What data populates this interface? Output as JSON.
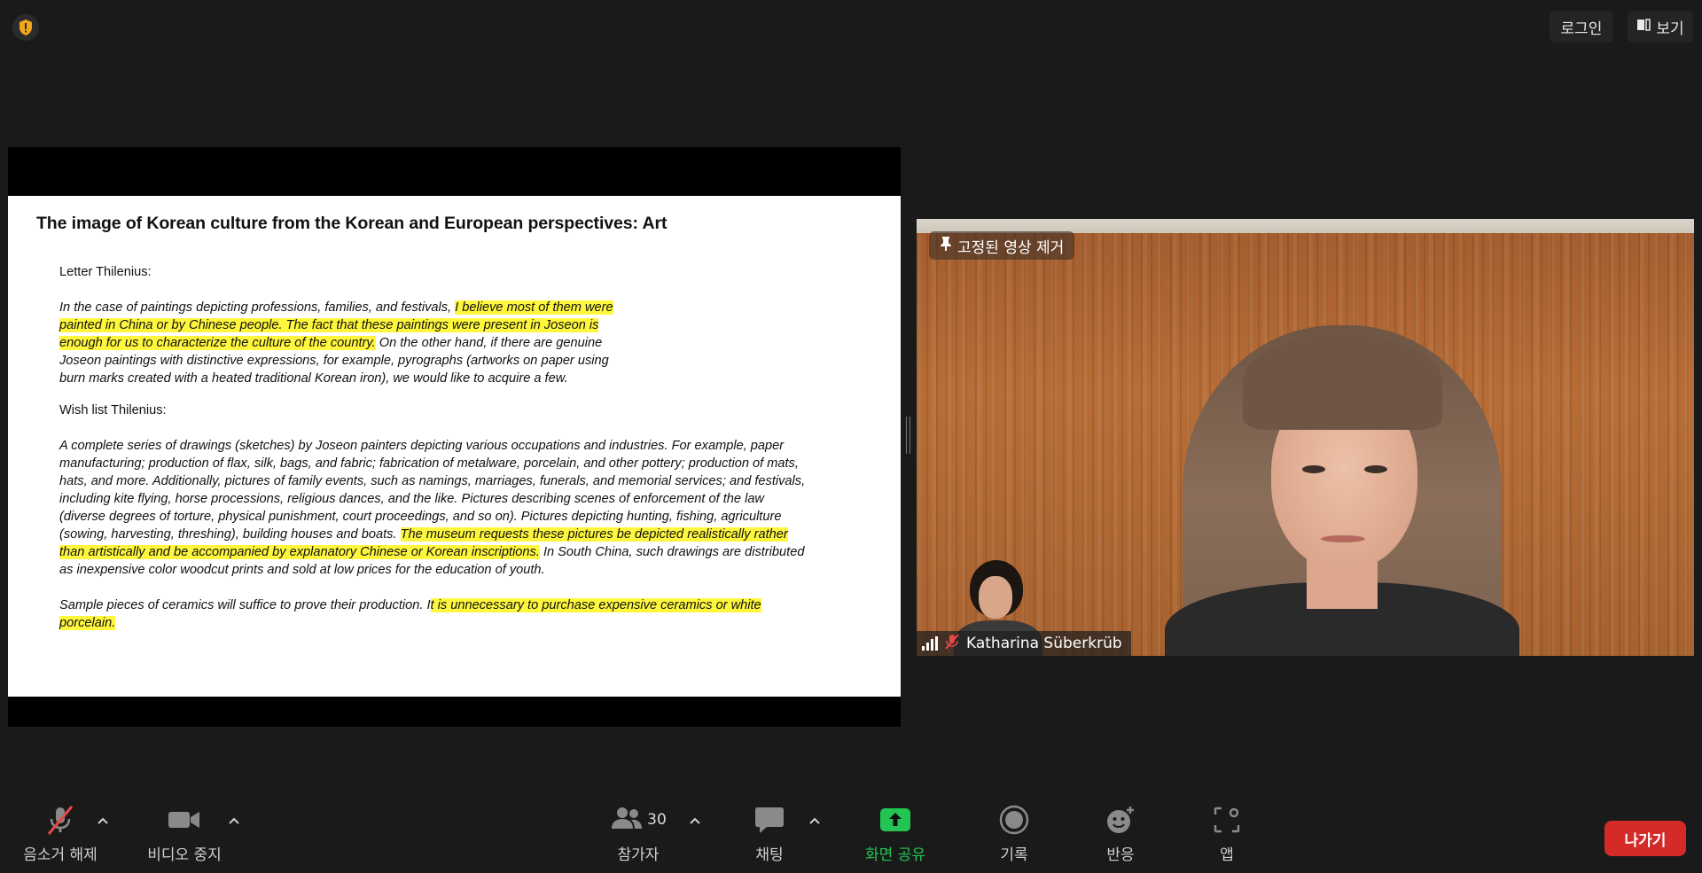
{
  "top": {
    "login_label": "로그인",
    "view_label": "보기"
  },
  "slide": {
    "title": "The image of Korean culture from the Korean and European perspectives: Art",
    "letter_label": "Letter Thilenius:",
    "p1": [
      {
        "t": "In the case of paintings depicting professions, families, and festivals, ",
        "hl": false
      },
      {
        "t": "I believe most of them were painted in China or by Chinese people. The fact that these paintings were present in Joseon is enough for us to characterize the culture of the country.",
        "hl": true
      },
      {
        "t": " On the other hand, if there are genuine Joseon paintings with distinctive expressions, for example, pyrographs (artworks on paper using burn marks created with a heated traditional Korean iron), we would like to acquire a few.",
        "hl": false
      }
    ],
    "wish_label": "Wish list Thilenius:",
    "p2": [
      {
        "t": "A complete series of drawings (sketches) by Joseon painters depicting various occupations and industries. For example, paper manufacturing; production of flax, silk, bags, and fabric; fabrication of metalware, porcelain, and other pottery; production of mats, hats, and more. Additionally, pictures of family events, such as namings, marriages, funerals, and memorial services; and festivals, including kite flying, horse processions, religious dances, and the like. Pictures describing scenes of enforcement of the law (diverse degrees of torture, physical punishment, court proceedings, and so on). Pictures depicting hunting, fishing, agriculture (sowing, harvesting, threshing), building houses and boats. ",
        "hl": false
      },
      {
        "t": "The museum requests these pictures be depicted realistically rather than artistically and be accompanied by explanatory Chinese or Korean inscriptions.",
        "hl": true
      },
      {
        "t": " In South China, such drawings are distributed as inexpensive color woodcut prints and sold at low prices for the education of youth.",
        "hl": false
      }
    ],
    "p3": [
      {
        "t": "Sample pieces of ceramics will suffice to prove their production. I",
        "hl": false
      },
      {
        "t": "t is unnecessary to purchase expensive ceramics or white porcelain.",
        "hl": true
      }
    ]
  },
  "video": {
    "pin_label": "고정된 영상 제거",
    "participant_name": "Katharina Süberkrüb"
  },
  "toolbar": {
    "mute": "음소거 해제",
    "video": "비디오 중지",
    "participants": "참가자",
    "participants_count": "30",
    "chat": "채팅",
    "share": "화면 공유",
    "record": "기록",
    "reactions": "반응",
    "apps": "앱",
    "leave": "나가기"
  },
  "colors": {
    "share_green": "#23c552",
    "leave_red": "#d42a28",
    "highlight": "#fff73d"
  }
}
